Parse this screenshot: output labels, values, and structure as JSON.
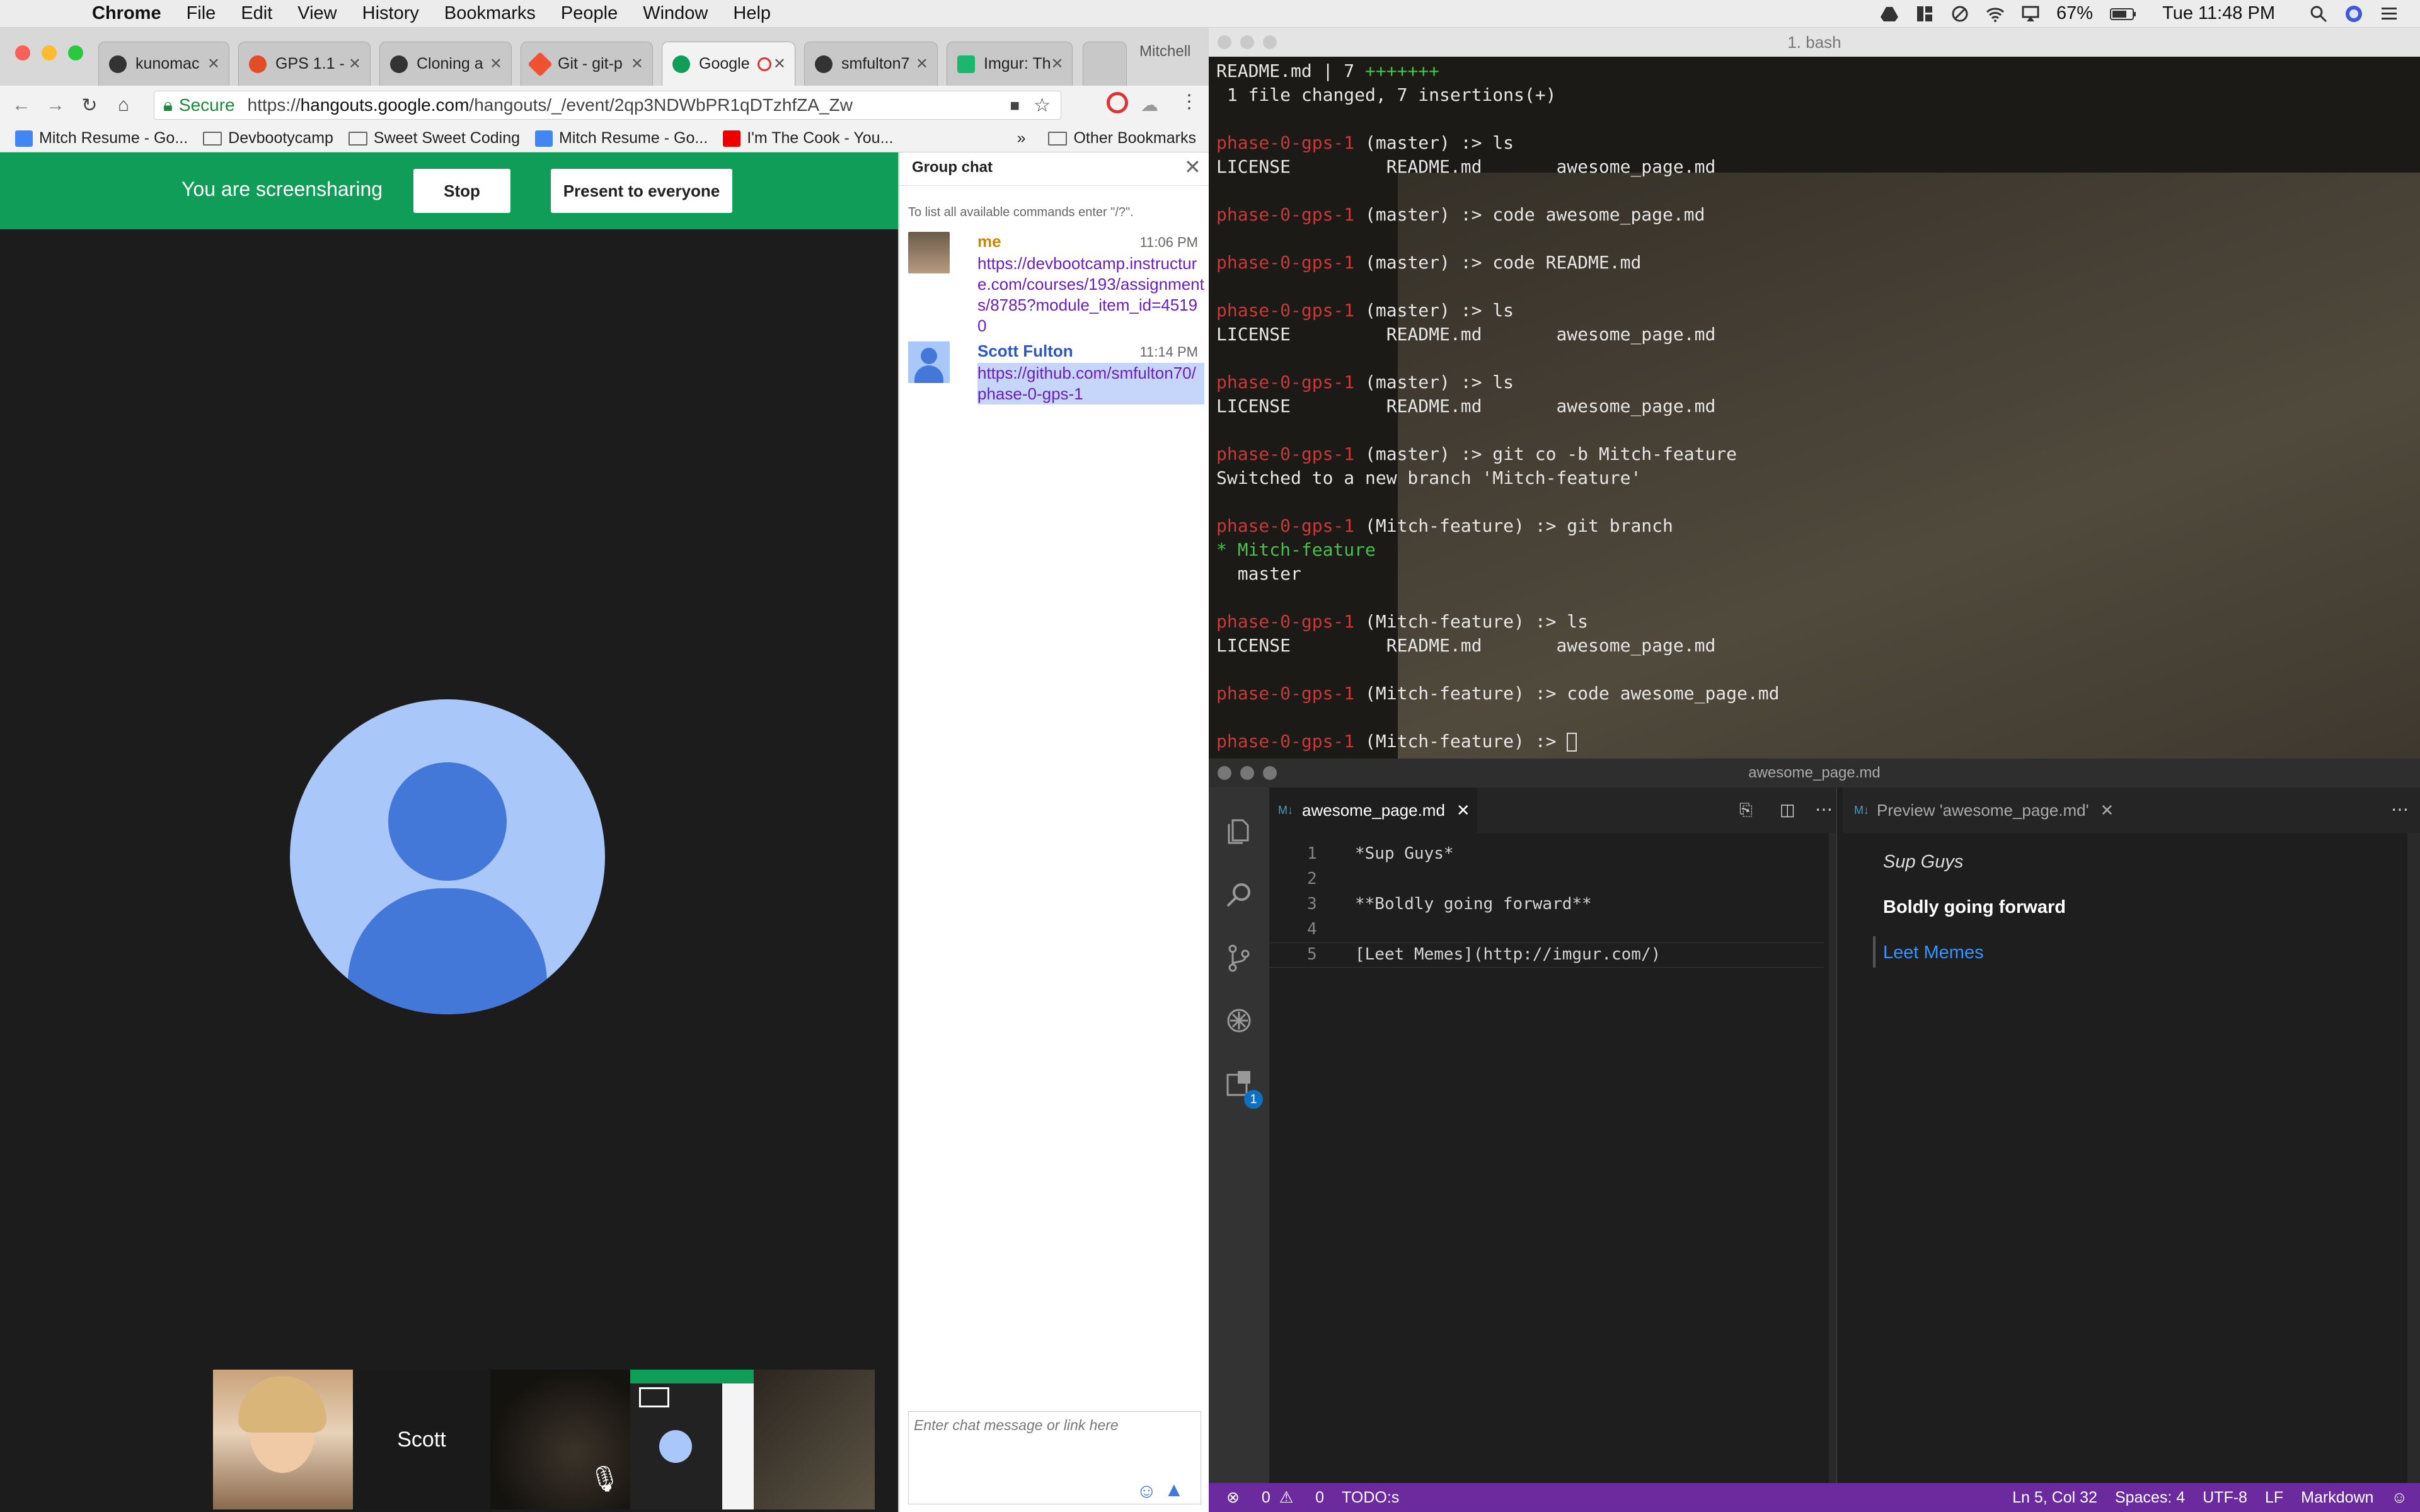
{
  "menubar": {
    "app": "Chrome",
    "items": [
      "File",
      "Edit",
      "View",
      "History",
      "Bookmarks",
      "People",
      "Window",
      "Help"
    ],
    "battery": "67%",
    "clock": "Tue 11:48 PM"
  },
  "browser": {
    "tabs": [
      {
        "label": "kunomac",
        "color": "#333333"
      },
      {
        "label": "GPS 1.1 -",
        "color": "#e34c26"
      },
      {
        "label": "Cloning a",
        "color": "#333333"
      },
      {
        "label": "Git - git-p",
        "color": "#f05133"
      },
      {
        "label": "Google",
        "color": "#0f9d58"
      },
      {
        "label": "smfulton7",
        "color": "#333333"
      },
      {
        "label": "Imgur: Th",
        "color": "#1bb76e"
      }
    ],
    "profile_label": "Mitchell",
    "url_secure": "Secure",
    "url_prefix": "https://",
    "url_host": "hangouts.google.com",
    "url_path": "/hangouts/_/event/2qp3NDWbPR1qDTzhfZA_Zw",
    "bookmarks": [
      {
        "label": "Mitch Resume - Go...",
        "kind": "doc"
      },
      {
        "label": "Devbootycamp",
        "kind": "folder"
      },
      {
        "label": "Sweet Sweet Coding",
        "kind": "folder"
      },
      {
        "label": "Mitch Resume - Go...",
        "kind": "doc"
      },
      {
        "label": "I'm The Cook - You...",
        "kind": "youtube"
      }
    ],
    "other_bookmarks": "Other Bookmarks",
    "overflow": "»"
  },
  "hangout": {
    "share_text": "You are screensharing",
    "stop_label": "Stop",
    "present_label": "Present to everyone",
    "thumb_name": "Scott",
    "accent": "#0f9d58"
  },
  "chat": {
    "title": "Group chat",
    "hint": "To list all available commands enter \"/?\".",
    "messages": [
      {
        "name": "me",
        "time": "11:06 PM",
        "text": "https://devbootcamp.instructure.com/courses/193/assignments/8785?module_item_id=45190"
      },
      {
        "name": "Scott Fulton",
        "time": "11:14 PM",
        "text": "https://github.com/smfulton70/phase-0-gps-1"
      }
    ],
    "input_placeholder": "Enter chat message or link here"
  },
  "terminal": {
    "title": "1. bash",
    "lines": [
      {
        "plain": "README.md | 7 ",
        "green": "+++++++"
      },
      {
        "plain": " 1 file changed, 7 insertions(+)"
      },
      {
        "plain": ""
      },
      {
        "prompt": "phase-0-gps-1",
        "rest": " (master) :> ls"
      },
      {
        "plain": "LICENSE         README.md       awesome_page.md"
      },
      {
        "plain": ""
      },
      {
        "prompt": "phase-0-gps-1",
        "rest": " (master) :> code awesome_page.md"
      },
      {
        "plain": ""
      },
      {
        "prompt": "phase-0-gps-1",
        "rest": " (master) :> code README.md"
      },
      {
        "plain": ""
      },
      {
        "prompt": "phase-0-gps-1",
        "rest": " (master) :> ls"
      },
      {
        "plain": "LICENSE         README.md       awesome_page.md"
      },
      {
        "plain": ""
      },
      {
        "prompt": "phase-0-gps-1",
        "rest": " (master) :> ls"
      },
      {
        "plain": "LICENSE         README.md       awesome_page.md"
      },
      {
        "plain": ""
      },
      {
        "prompt": "phase-0-gps-1",
        "rest": " (master) :> git co -b Mitch-feature"
      },
      {
        "plain": "Switched to a new branch 'Mitch-feature'"
      },
      {
        "plain": ""
      },
      {
        "prompt": "phase-0-gps-1",
        "rest": " (Mitch-feature) :> git branch"
      },
      {
        "green": "* Mitch-feature"
      },
      {
        "plain": "  master"
      },
      {
        "plain": ""
      },
      {
        "prompt": "phase-0-gps-1",
        "rest": " (Mitch-feature) :> ls"
      },
      {
        "plain": "LICENSE         README.md       awesome_page.md"
      },
      {
        "plain": ""
      },
      {
        "prompt": "phase-0-gps-1",
        "rest": " (Mitch-feature) :> code awesome_page.md"
      },
      {
        "plain": ""
      },
      {
        "prompt": "phase-0-gps-1",
        "rest": " (Mitch-feature) :> ",
        "cursor": true
      }
    ]
  },
  "vscode": {
    "title": "awesome_page.md",
    "tab_label": "awesome_page.md",
    "preview_tab_label": "Preview 'awesome_page.md'",
    "scm_badge": "1",
    "code_lines": [
      {
        "n": "1",
        "text": "*Sup Guys*"
      },
      {
        "n": "2",
        "text": ""
      },
      {
        "n": "3",
        "text": "**Boldly going forward**"
      },
      {
        "n": "4",
        "text": ""
      },
      {
        "n": "5",
        "text": "[Leet Memes](http://imgur.com/)"
      }
    ],
    "preview": {
      "italic": "Sup Guys",
      "bold": "Boldly going forward",
      "link": "Leet Memes"
    },
    "status": {
      "errors": "0",
      "warnings": "0",
      "todo": "TODO:s",
      "position": "Ln 5, Col 32",
      "spaces": "Spaces: 4",
      "encoding": "UTF-8",
      "eol": "LF",
      "language": "Markdown"
    },
    "status_color": "#6b2b9e"
  }
}
